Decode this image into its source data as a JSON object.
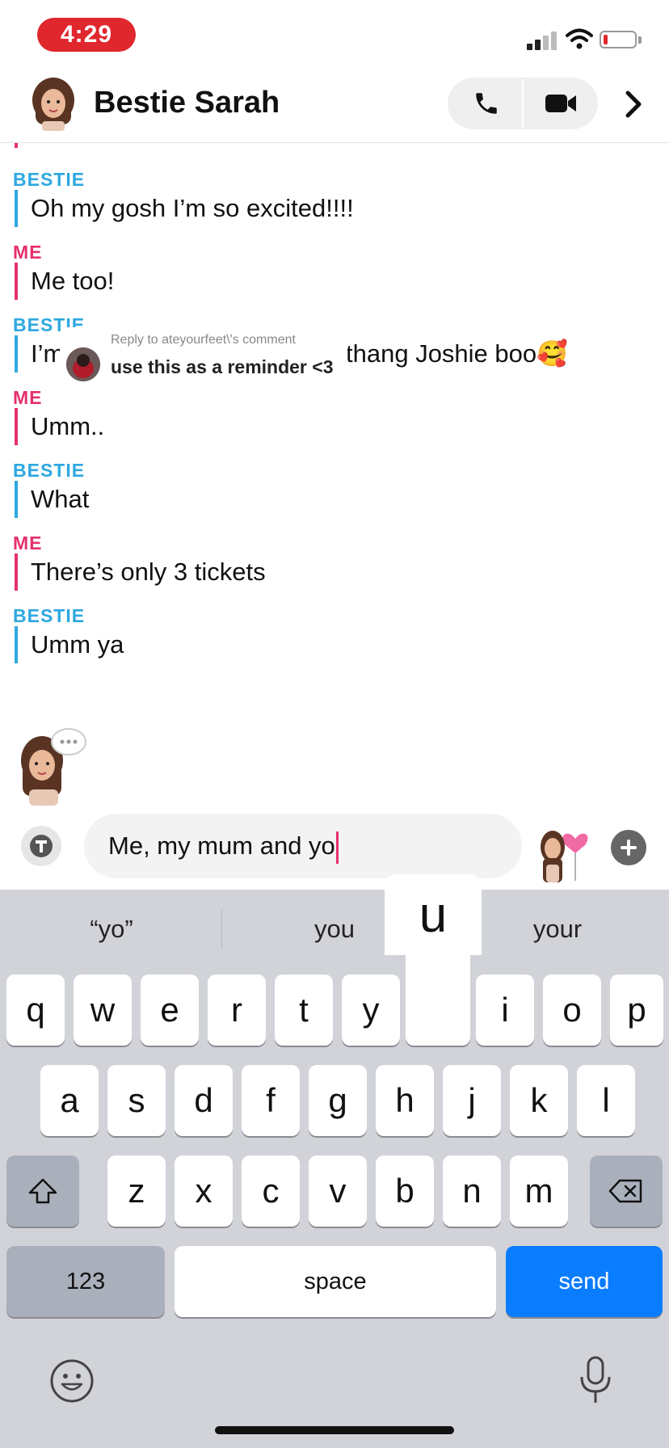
{
  "status_bar": {
    "time": "4:29"
  },
  "header": {
    "title": "Bestie Sarah"
  },
  "messages": [
    {
      "sender": "BESTIE",
      "text": "Oh my gosh I’m so excited!!!!"
    },
    {
      "sender": "ME",
      "text": "Me too!"
    },
    {
      "sender": "BESTIE",
      "text": "I’m",
      "text_end": "thang Joshie boo🥰"
    },
    {
      "sender": "ME",
      "text": "Umm.."
    },
    {
      "sender": "BESTIE",
      "text": "What"
    },
    {
      "sender": "ME",
      "text": "There’s only 3 tickets"
    },
    {
      "sender": "BESTIE",
      "text": "Umm ya"
    }
  ],
  "reply_overlay": {
    "caption": "Reply to ateyourfeet\\'s comment",
    "text": "use this as a reminder <3"
  },
  "composer": {
    "input_value": "Me, my mum and yo"
  },
  "keyboard": {
    "suggestions": [
      "“yo”",
      "you",
      "your"
    ],
    "popup_key": "u",
    "row1": [
      "q",
      "w",
      "e",
      "r",
      "t",
      "y",
      "u",
      "i",
      "o",
      "p"
    ],
    "row2": [
      "a",
      "s",
      "d",
      "f",
      "g",
      "h",
      "j",
      "k",
      "l"
    ],
    "row3": [
      "z",
      "x",
      "c",
      "v",
      "b",
      "n",
      "m"
    ],
    "numbers_label": "123",
    "space_label": "space",
    "send_label": "send"
  },
  "colors": {
    "bestie": "#2ea8e0",
    "me": "#e5306d",
    "send": "#0a7cff",
    "time_pill": "#e0272e"
  }
}
